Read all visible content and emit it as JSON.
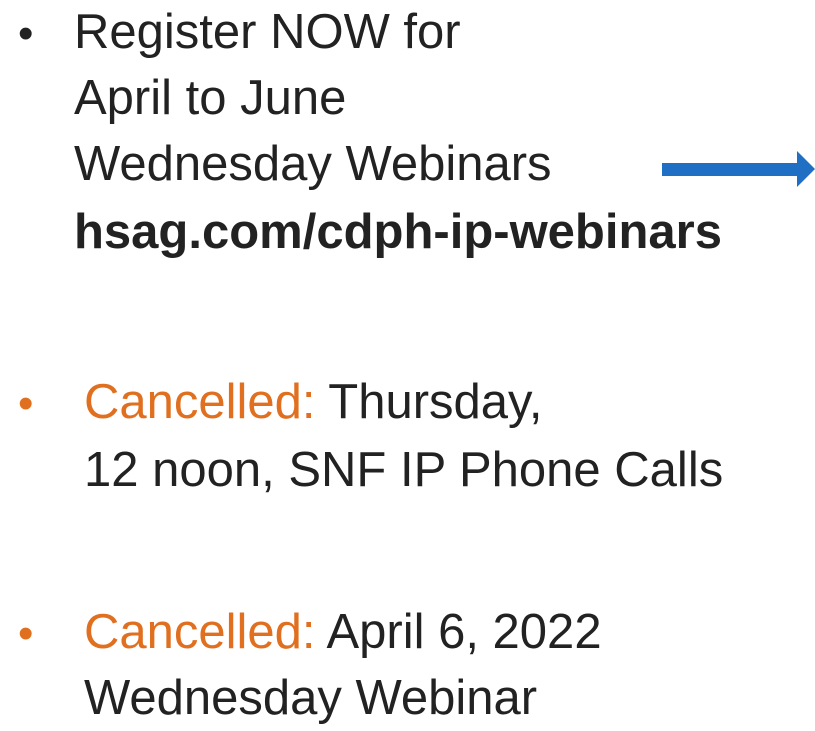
{
  "item1": {
    "bullet": "•",
    "line1": "Register NOW for",
    "line2": "April to June",
    "line3": "Wednesday Webinars",
    "url": "hsag.com/cdph-ip-webinars",
    "arrow_color": "#1F6FC4"
  },
  "item2": {
    "bullet": "•",
    "label": "Cancelled:",
    "line1_rest": " Thursday,",
    "line2": "12 noon, SNF IP Phone Calls",
    "label_color": "#E07020"
  },
  "item3": {
    "bullet": "•",
    "label": "Cancelled:",
    "line1_rest": " April 6, 2022",
    "line2": "Wednesday Webinar",
    "label_color": "#E07020"
  }
}
